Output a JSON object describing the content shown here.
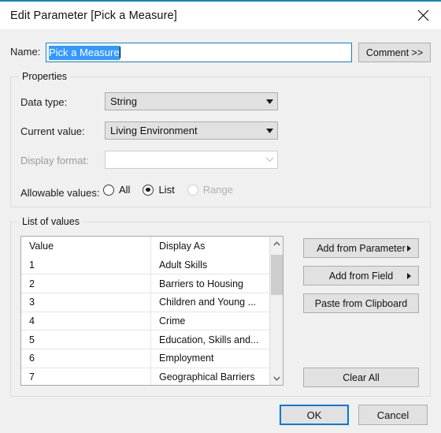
{
  "window": {
    "title": "Edit Parameter [Pick a Measure]",
    "close_icon": "close-icon",
    "accent_color": "#1a7fc1"
  },
  "name_row": {
    "label": "Name:",
    "value": "Pick a Measure",
    "placeholder": "",
    "comment_button": "Comment >>"
  },
  "properties": {
    "group_title": "Properties",
    "data_type": {
      "label": "Data type:",
      "value": "String"
    },
    "current_value": {
      "label": "Current value:",
      "value": "Living Environment"
    },
    "display_format": {
      "label": "Display format:",
      "value": "",
      "disabled": true
    },
    "allowable_values": {
      "label": "Allowable values:",
      "options": [
        {
          "label": "All",
          "checked": false,
          "disabled": false
        },
        {
          "label": "List",
          "checked": true,
          "disabled": false
        },
        {
          "label": "Range",
          "checked": false,
          "disabled": true
        }
      ]
    }
  },
  "list_of_values": {
    "group_title": "List of values",
    "columns": [
      "Value",
      "Display As"
    ],
    "rows": [
      {
        "value": "1",
        "display_as": "Adult Skills"
      },
      {
        "value": "2",
        "display_as": "Barriers to Housing"
      },
      {
        "value": "3",
        "display_as": "Children and Young ..."
      },
      {
        "value": "4",
        "display_as": "Crime"
      },
      {
        "value": "5",
        "display_as": "Education, Skills and..."
      },
      {
        "value": "6",
        "display_as": "Employment"
      },
      {
        "value": "7",
        "display_as": "Geographical Barriers"
      }
    ],
    "scrollbar": {
      "up_icon": "chevron-up-icon",
      "down_icon": "chevron-down-icon"
    },
    "buttons": [
      {
        "label": "Add from Parameter",
        "has_submenu": true
      },
      {
        "label": "Add from Field",
        "has_submenu": true
      },
      {
        "label": "Paste from Clipboard",
        "has_submenu": false
      }
    ],
    "clear_all_button": "Clear All"
  },
  "footer": {
    "ok": "OK",
    "cancel": "Cancel"
  }
}
